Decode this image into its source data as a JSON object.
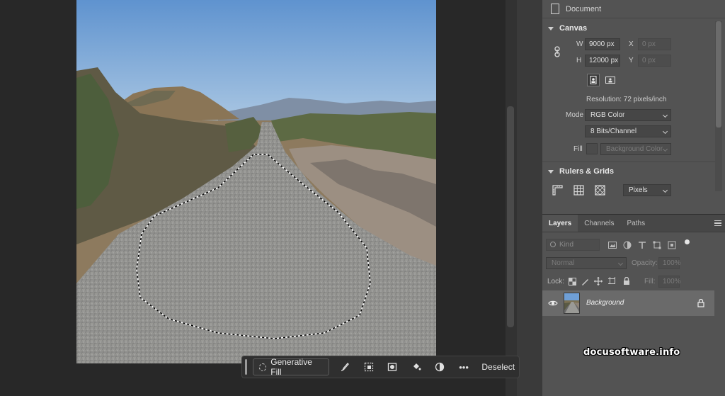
{
  "taskbar": {
    "generative_fill_label": "Generative Fill",
    "icons": [
      "brush-icon",
      "select-subject-icon",
      "mask-icon",
      "fill-bucket-icon",
      "adjustment-icon",
      "more-icon"
    ],
    "more_glyph": "•••",
    "deselect_label": "Deselect"
  },
  "properties": {
    "document_label": "Document",
    "canvas": {
      "section_label": "Canvas",
      "w_label": "W",
      "w_value": "9000 px",
      "h_label": "H",
      "h_value": "12000 px",
      "x_label": "X",
      "x_placeholder": "0 px",
      "y_label": "Y",
      "y_placeholder": "0 px",
      "resolution": "Resolution: 72 pixels/inch",
      "mode_label": "Mode",
      "mode_value": "RGB Color",
      "bits_value": "8 Bits/Channel",
      "fill_label": "Fill",
      "fill_value": "Background Color"
    },
    "rulers": {
      "section_label": "Rulers & Grids",
      "units_value": "Pixels"
    }
  },
  "layers": {
    "tabs": [
      "Layers",
      "Channels",
      "Paths"
    ],
    "active_tab": "Layers",
    "kind_placeholder": "Kind",
    "blend_mode": "Normal",
    "opacity_label": "Opacity:",
    "opacity_value": "100%",
    "lock_label": "Lock:",
    "fill_label": "Fill:",
    "fill_value": "100%",
    "items": [
      {
        "name": "Background",
        "visible": true,
        "locked": true
      }
    ]
  },
  "watermark": "docusoftware.info"
}
